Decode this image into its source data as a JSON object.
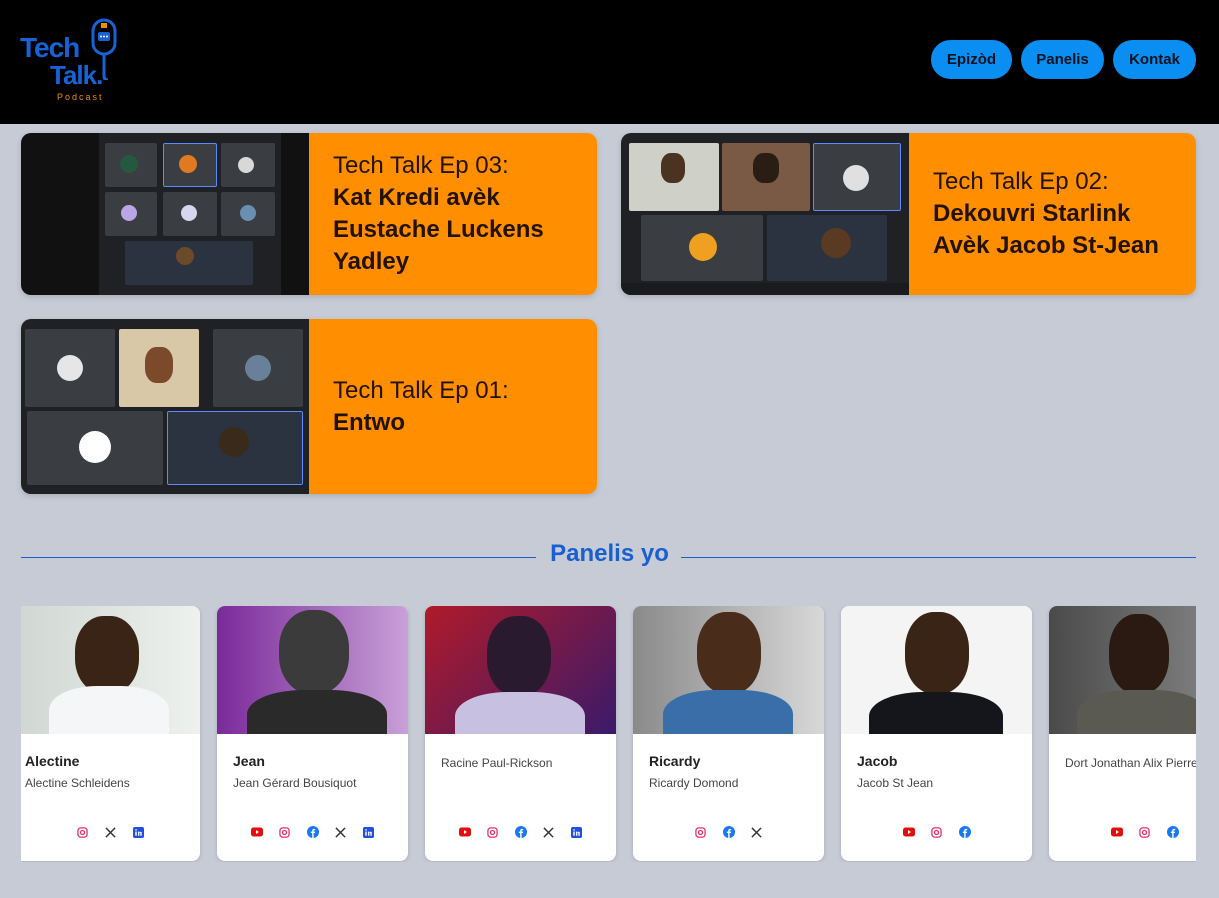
{
  "logo": {
    "line1": "Tech",
    "line2": "Talk.",
    "tagline": "Podcast"
  },
  "nav": {
    "episodes": "Epizòd",
    "panelists": "Panelis",
    "contact": "Kontak"
  },
  "episodes": [
    {
      "number": "Tech Talk Ep 03:",
      "title": "Kat Kredi avèk Eustache Luckens Yadley"
    },
    {
      "number": "Tech Talk Ep 02:",
      "title": "Dekouvri Starlink Avèk Jacob St-Jean"
    },
    {
      "number": "Tech Talk Ep 01:",
      "title": "Entwo"
    }
  ],
  "panelists_section": {
    "title": "Panelis yo"
  },
  "panelists": [
    {
      "name": "Alectine",
      "full_name": "Alectine Schleidens",
      "socials": [
        "instagram-icon",
        "x-icon",
        "linkedin-icon"
      ]
    },
    {
      "name": "Jean",
      "full_name": "Jean Gérard Bousiquot",
      "socials": [
        "youtube-icon",
        "instagram-icon",
        "facebook-icon",
        "x-icon",
        "linkedin-icon"
      ]
    },
    {
      "name": "",
      "full_name": "Racine Paul-Rickson",
      "socials": [
        "youtube-icon",
        "instagram-icon",
        "facebook-icon",
        "x-icon",
        "linkedin-icon"
      ]
    },
    {
      "name": "Ricardy",
      "full_name": "Ricardy Domond",
      "socials": [
        "instagram-icon",
        "facebook-icon",
        "x-icon"
      ]
    },
    {
      "name": "Jacob",
      "full_name": "Jacob St Jean",
      "socials": [
        "youtube-icon",
        "instagram-icon",
        "facebook-icon"
      ]
    },
    {
      "name": "",
      "full_name": "Dort Jonathan Alix Pierre",
      "socials": [
        "youtube-icon",
        "instagram-icon",
        "facebook-icon"
      ]
    }
  ],
  "colors": {
    "accent": "#ff8f00",
    "nav": "#0a8ef2",
    "heading": "#1a5fd0",
    "background": "#c6cbd5"
  }
}
